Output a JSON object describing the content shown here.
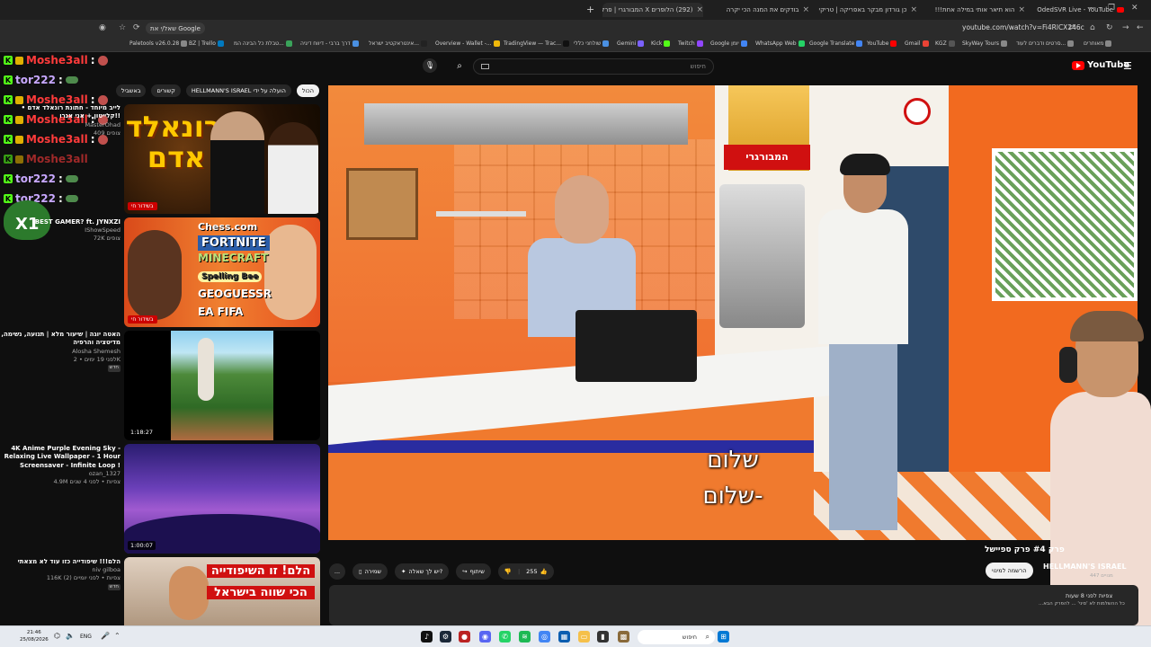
{
  "browser": {
    "tabs": [
      {
        "label": "OdedSVR Live - YouTube"
      },
      {
        "label": "הוא תיאר אותי במילה אחת!!!"
      },
      {
        "label": "כן גורדון מבקר באפריקה | טריקי"
      },
      {
        "label": "בודקים את המנה הכי יקרה"
      },
      {
        "label": "(292) הלופרים X המבורגרי | פרק"
      }
    ],
    "url": "youtube.com/watch?v=Fi4RlCX246c",
    "google_chip": "שאל/י את Google",
    "bookmarks": [
      "Paletools v26.0.28",
      "BZ | Trello",
      "טבלת כל הבינה המ...",
      "דרך ברבי - דיווח דיגיה",
      "אינטראקטיב ישראל...",
      "Overview - Wallet -...",
      "TradingView — Trac...",
      "שולחני כללי",
      "Gemini",
      "Kick",
      "Twitch",
      "Google יומן",
      "WhatsApp Web",
      "Google Translate",
      "YouTube",
      "Gmail",
      "KGZ",
      "SkyWay Tours",
      "סרטים ודברים לעוד...",
      "מאוחרים"
    ]
  },
  "chat": {
    "lines": [
      {
        "user": "Moshe3all",
        "sep": ":",
        "color": "red"
      },
      {
        "user": "tor222",
        "sep": ":",
        "color": "purple"
      },
      {
        "user": "Moshe3all",
        "sep": ":",
        "color": "red"
      },
      {
        "user": "Moshe3all",
        "sep": ":",
        "color": "red"
      },
      {
        "user": "Moshe3all",
        "sep": ":",
        "color": "red"
      },
      {
        "user": "Moshe3all",
        "sep": ":",
        "color": "red"
      },
      {
        "user": "tor222",
        "sep": ":",
        "color": "purple"
      },
      {
        "user": "tor222",
        "sep": ":",
        "color": "purple"
      }
    ],
    "emote": "X1"
  },
  "youtube": {
    "search_placeholder": "חיפוש",
    "logo_text": "YouTube",
    "chips": [
      "הכול",
      "הועלה על ידי HELLMANN'S ISRAEL",
      "קשורים",
      "באשביל"
    ],
    "recommendations": [
      {
        "title": "",
        "channel": "",
        "views": "",
        "badge": "בשידור חי",
        "thumb_text": "רונאלד אדם"
      },
      {
        "title": "BEST GAMER? ft. JYNXZI",
        "channel": "IShowSpeed",
        "views": "72K צופים",
        "badge": "בשידור חי",
        "thumb_text": "Chess.com FORTNITE MINECRAFT Spelling Bee GEOGUESSR FIFA"
      },
      {
        "title": "האטה יוגה | שיעור מלא | תנועה, נשימה, מדיטציה והרפיה",
        "channel": "Alosha Shemesh",
        "views": "לפני 19 ימים • 2K",
        "badge": "חדש",
        "duration": "1:18:27"
      },
      {
        "title": "4K Anime Purple Evening Sky - Relaxing Live Wallpaper - 1 Hour Screensaver - Infinite Loop !",
        "channel": "ozan_1327",
        "views": "4.9M צפיות • לפני 4 שנים",
        "duration": "1:00:07"
      },
      {
        "title": "הלם!!! שיפודייה כזו עוד לא מצאתי",
        "channel": "niv gilboa",
        "views": "116K צפיות • לפני יומיים (2)",
        "badge": "חדש",
        "thumb_line1": "הלם! זו השיפודייה",
        "thumb_line2": "הכי שווה בישראל"
      }
    ],
    "first_rec_meta": {
      "title": "לייב מיוחד - חתונת רונאלד אדם • קלייטון + אני אגרו!!",
      "channel": "MasterOhad",
      "views": "409 צופים"
    },
    "video": {
      "subtitle_line1": "שלום",
      "subtitle_line2": "-שלום",
      "poster_label": "המבורגרי",
      "title": "פרק #4 פרק ספיישל",
      "channel": "HELLMANN'S ISRAEL",
      "subscribers": "447 מנויים",
      "subscribe_label": "הרשמה למינוי",
      "likes": "255",
      "share_label": "שיתוף",
      "ask_label": "יש לך שאלה?",
      "save_label": "שמירה",
      "more_label": "...",
      "desc_meta": "צפיות לפני 8 שעות",
      "desc_text": "כל ההשלמות לא 'סיני' ... להפרק הבא..."
    }
  },
  "taskbar": {
    "time": "21:46",
    "date": "25/08/2026",
    "lang": "ENG",
    "search_placeholder": "חיפוש"
  }
}
